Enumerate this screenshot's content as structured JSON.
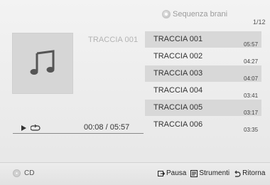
{
  "header": {
    "sequence_label": "Sequenza brani",
    "sequence_icon": "circle-dots-icon",
    "page_indicator": "1/12"
  },
  "now_playing": {
    "title": "TRACCIA 001",
    "art_icon": "music-note-icon",
    "time": "00:08 / 05:57",
    "elapsed_seconds": 8,
    "total_seconds": 357
  },
  "tracks": [
    {
      "title": "TRACCIA 001",
      "duration": "05:57"
    },
    {
      "title": "TRACCIA 002",
      "duration": "04:27"
    },
    {
      "title": "TRACCIA 003",
      "duration": "04:07"
    },
    {
      "title": "TRACCIA 004",
      "duration": "03:41"
    },
    {
      "title": "TRACCIA 005",
      "duration": "03:17"
    },
    {
      "title": "TRACCIA 006",
      "duration": "03:35"
    }
  ],
  "footer": {
    "source_label": "CD",
    "source_icon": "disc-icon",
    "pause_label": "Pausa",
    "pause_icon": "enter-icon",
    "tools_label": "Strumenti",
    "tools_icon": "tools-icon",
    "back_label": "Ritorna",
    "back_icon": "return-icon"
  },
  "colors": {
    "accent_row": "#d8d8d8",
    "text": "#333333"
  }
}
